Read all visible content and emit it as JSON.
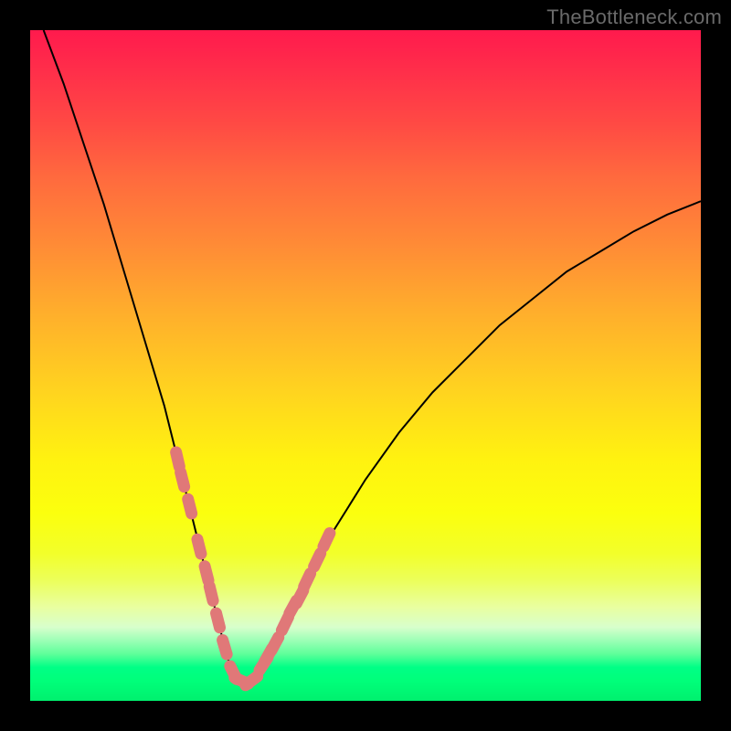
{
  "attribution": "TheBottleneck.com",
  "chart_data": {
    "type": "line",
    "title": "",
    "xlabel": "",
    "ylabel": "",
    "xlim": [
      0,
      100
    ],
    "ylim": [
      0,
      100
    ],
    "grid": false,
    "legend": false,
    "series": [
      {
        "name": "bottleneck-curve",
        "color": "#000000",
        "x": [
          2,
          5,
          8,
          11,
          14,
          17,
          20,
          22,
          24,
          26,
          28,
          29,
          30,
          31,
          32,
          33,
          35,
          37,
          40,
          45,
          50,
          55,
          60,
          65,
          70,
          75,
          80,
          85,
          90,
          95,
          100
        ],
        "y": [
          100,
          92,
          83,
          74,
          64,
          54,
          44,
          36,
          28,
          20,
          12,
          8,
          4.5,
          3,
          2.5,
          3,
          5,
          9,
          15,
          25,
          33,
          40,
          46,
          51,
          56,
          60,
          64,
          67,
          70,
          72.5,
          74.5
        ]
      },
      {
        "name": "dot-markers",
        "color": "#e07878",
        "type": "scatter",
        "x": [
          22.0,
          22.7,
          23.8,
          25.2,
          26.3,
          27.0,
          28.0,
          29.0,
          30.3,
          31.5,
          33.0,
          34.8,
          35.5,
          36.5,
          38.0,
          39.2,
          40.2,
          41.3,
          42.8,
          44.2
        ],
        "y": [
          36.0,
          33.0,
          29.0,
          23.0,
          19.0,
          16.0,
          12.0,
          8.0,
          4.2,
          3.0,
          3.0,
          5.5,
          6.8,
          8.5,
          11.5,
          14.0,
          15.5,
          18.0,
          21.0,
          24.0
        ]
      }
    ],
    "background": {
      "type": "vertical-gradient",
      "stops": [
        {
          "pos": 0.0,
          "color": "#ff1a4d"
        },
        {
          "pos": 0.32,
          "color": "#ff8b36"
        },
        {
          "pos": 0.64,
          "color": "#fff210"
        },
        {
          "pos": 0.86,
          "color": "#e9ffa0"
        },
        {
          "pos": 0.95,
          "color": "#00ff86"
        },
        {
          "pos": 1.0,
          "color": "#00f06e"
        }
      ]
    }
  }
}
